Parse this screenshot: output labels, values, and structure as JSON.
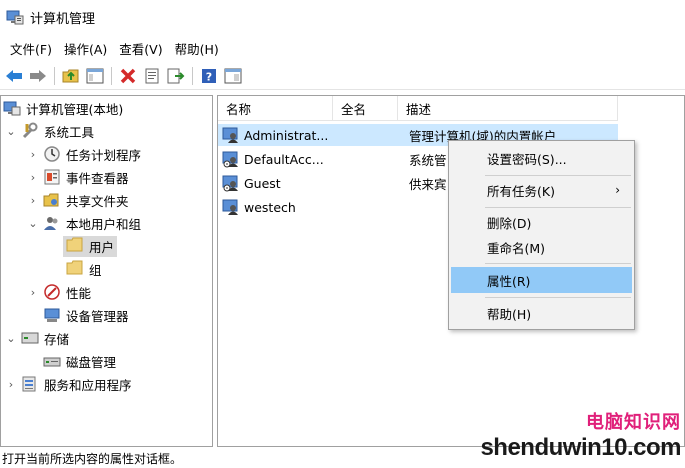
{
  "window": {
    "title": "计算机管理"
  },
  "menu": {
    "items": [
      "文件(F)",
      "操作(A)",
      "查看(V)",
      "帮助(H)"
    ]
  },
  "toolbar": {
    "buttons": [
      "back-arrow-icon",
      "forward-arrow-icon",
      "up-folder-icon",
      "show-hide-tree-icon",
      "delete-icon",
      "properties-sheet-icon",
      "export-list-icon",
      "help-icon",
      "view-toggle-icon"
    ]
  },
  "tree": {
    "items": [
      {
        "label": "计算机管理(本地)",
        "icon": "computer-management-icon",
        "level": 0,
        "expander": ""
      },
      {
        "label": "系统工具",
        "icon": "system-tools-icon",
        "level": 1,
        "expander": "expanded"
      },
      {
        "label": "任务计划程序",
        "icon": "task-scheduler-icon",
        "level": 2,
        "expander": "collapsed"
      },
      {
        "label": "事件查看器",
        "icon": "event-viewer-icon",
        "level": 2,
        "expander": "collapsed"
      },
      {
        "label": "共享文件夹",
        "icon": "shared-folders-icon",
        "level": 2,
        "expander": "collapsed"
      },
      {
        "label": "本地用户和组",
        "icon": "local-users-groups-icon",
        "level": 2,
        "expander": "expanded"
      },
      {
        "label": "用户",
        "icon": "folder-icon",
        "level": 3,
        "expander": "",
        "selected": true
      },
      {
        "label": "组",
        "icon": "folder-icon",
        "level": 3,
        "expander": ""
      },
      {
        "label": "性能",
        "icon": "performance-icon",
        "level": 2,
        "expander": "collapsed"
      },
      {
        "label": "设备管理器",
        "icon": "device-manager-icon",
        "level": 2,
        "expander": ""
      },
      {
        "label": "存储",
        "icon": "storage-icon",
        "level": 1,
        "expander": "expanded"
      },
      {
        "label": "磁盘管理",
        "icon": "disk-management-icon",
        "level": 2,
        "expander": ""
      },
      {
        "label": "服务和应用程序",
        "icon": "services-apps-icon",
        "level": 1,
        "expander": "collapsed"
      }
    ]
  },
  "list": {
    "columns": [
      "名称",
      "全名",
      "描述"
    ],
    "rows": [
      {
        "name": "Administrat...",
        "fullname": "",
        "description": "管理计算机(域)的内置帐户",
        "selected": true
      },
      {
        "name": "DefaultAcc...",
        "fullname": "",
        "description": "系统管"
      },
      {
        "name": "Guest",
        "fullname": "",
        "description": "供来宾"
      },
      {
        "name": "westech",
        "fullname": "",
        "description": ""
      }
    ]
  },
  "context_menu": {
    "items": [
      {
        "label": "设置密码(S)...",
        "submenu": false
      },
      {
        "label": "所有任务(K)",
        "submenu": true
      },
      {
        "label": "删除(D)",
        "submenu": false
      },
      {
        "label": "重命名(M)",
        "submenu": false
      },
      {
        "label": "属性(R)",
        "submenu": false,
        "highlighted": true
      },
      {
        "label": "帮助(H)",
        "submenu": false
      }
    ]
  },
  "status": {
    "text": "打开当前所选内容的属性对话框。"
  },
  "watermark": {
    "line1": "电脑知识网",
    "line2": "shenduwin10.com"
  },
  "colors": {
    "selection": "#cce8ff",
    "menu_highlight": "#91c9f7",
    "tree_selection": "#d9d9d9",
    "watermark_pink": "#e0207a"
  }
}
